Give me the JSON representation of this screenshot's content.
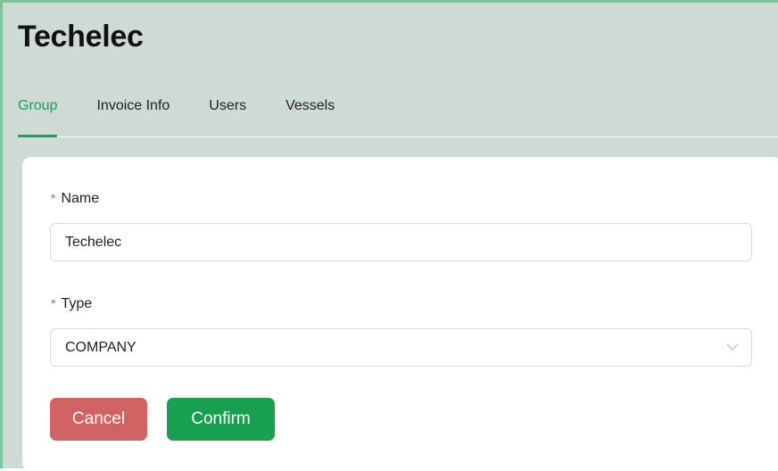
{
  "header": {
    "title": "Techelec"
  },
  "tabs": [
    {
      "label": "Group",
      "active": true
    },
    {
      "label": "Invoice Info",
      "active": false
    },
    {
      "label": "Users",
      "active": false
    },
    {
      "label": "Vessels",
      "active": false
    }
  ],
  "form": {
    "required_marker": "*",
    "name": {
      "label": "Name",
      "value": "Techelec"
    },
    "type": {
      "label": "Type",
      "selected": "COMPANY"
    },
    "cancel_label": "Cancel",
    "confirm_label": "Confirm"
  },
  "colors": {
    "background": "#cddbd4",
    "accent": "#17a05a",
    "cancel": "#d16363",
    "confirm": "#17a04f",
    "required": "#e34d4d"
  },
  "icons": {
    "select_arrow": "chevron-down-icon"
  }
}
